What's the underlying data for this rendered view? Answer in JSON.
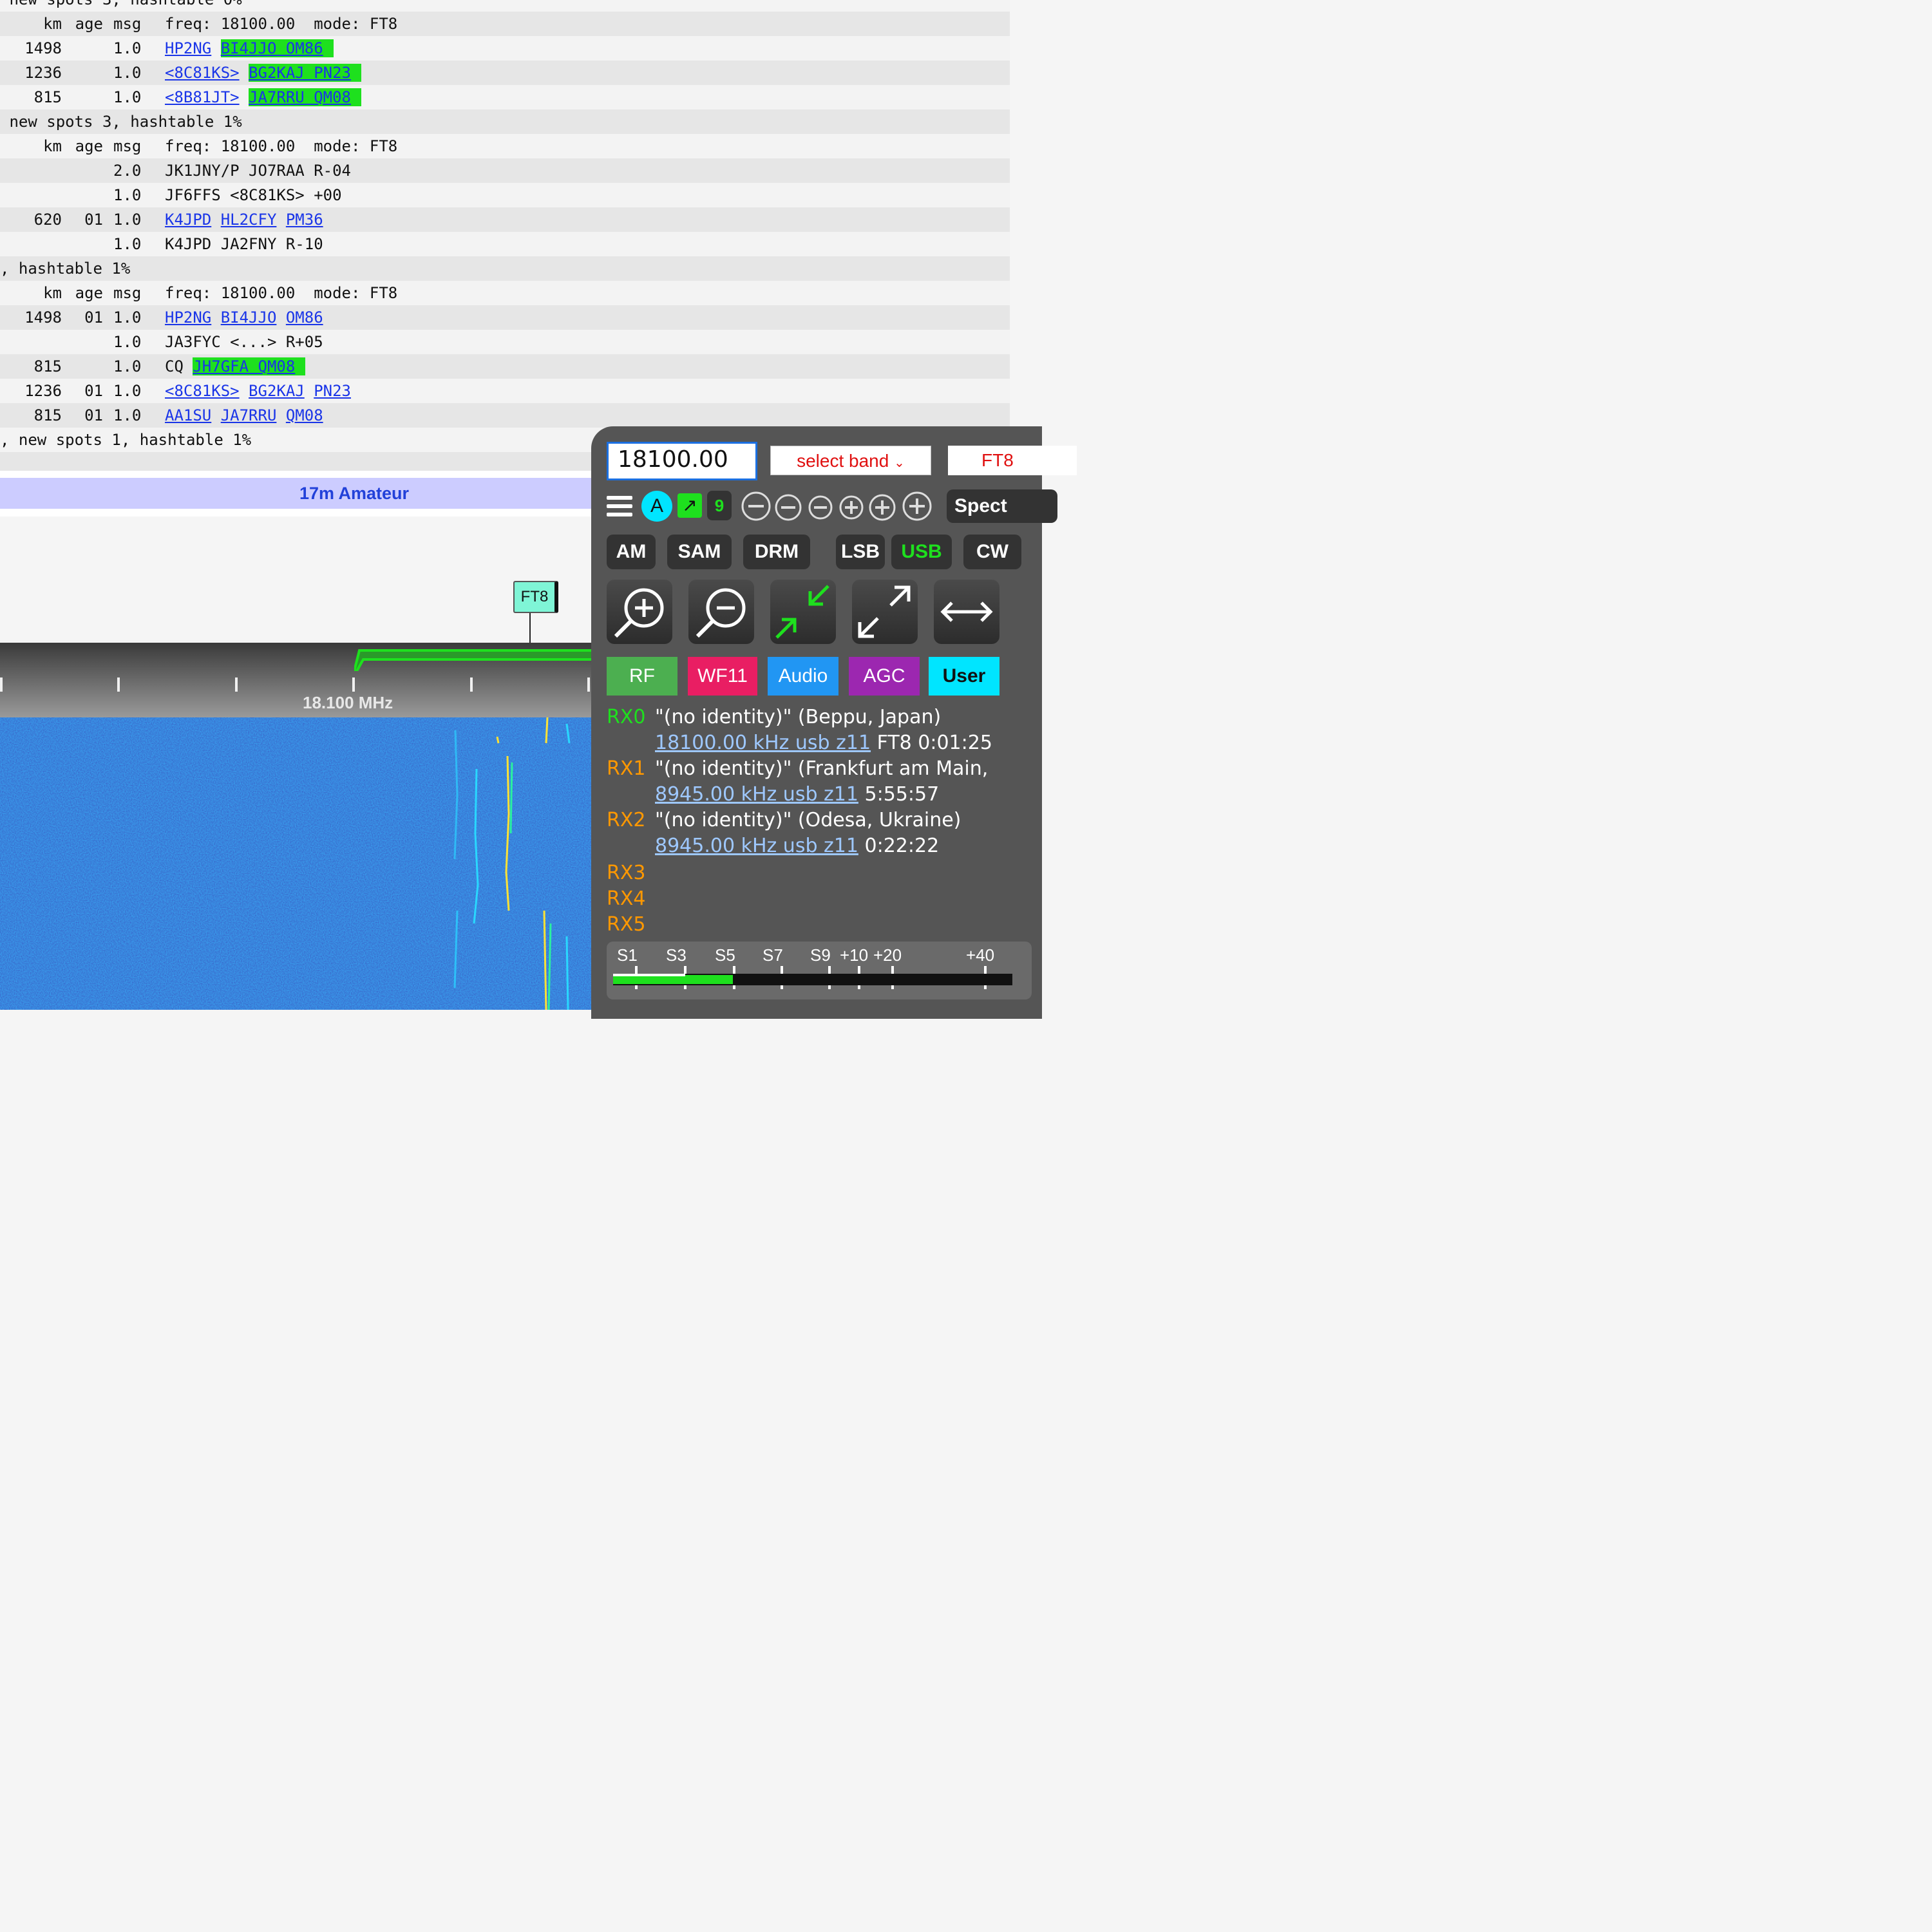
{
  "log": {
    "rows": [
      {
        "type": "status",
        "text": " new spots 3, hashtable 0%"
      },
      {
        "type": "header",
        "km": "km",
        "age": "age",
        "msg": "msg",
        "text": "freq: 18100.00  mode: FT8"
      },
      {
        "type": "spot",
        "km": "1498",
        "age": "",
        "msg": "1.0",
        "parts": [
          {
            "t": "HP2NG",
            "link": true
          },
          {
            "t": "BI4JJO OM86",
            "link": true,
            "hl": true
          }
        ]
      },
      {
        "type": "spot",
        "km": "1236",
        "age": "",
        "msg": "1.0",
        "parts": [
          {
            "t": "<8C81KS>",
            "link": true
          },
          {
            "t": "BG2KAJ PN23",
            "link": true,
            "hl": true
          }
        ]
      },
      {
        "type": "spot",
        "km": "815",
        "age": "",
        "msg": "1.0",
        "parts": [
          {
            "t": "<8B81JT>",
            "link": true
          },
          {
            "t": "JA7RRU QM08",
            "link": true,
            "hl": true
          }
        ]
      },
      {
        "type": "status",
        "text": " new spots 3, hashtable 1%"
      },
      {
        "type": "header",
        "km": "km",
        "age": "age",
        "msg": "msg",
        "text": "freq: 18100.00  mode: FT8"
      },
      {
        "type": "spot",
        "km": "",
        "age": "",
        "msg": "2.0",
        "parts": [
          {
            "t": "JK1JNY/P JO7RAA R-04"
          }
        ]
      },
      {
        "type": "spot",
        "km": "",
        "age": "",
        "msg": "1.0",
        "parts": [
          {
            "t": "JF6FFS <8C81KS> +00"
          }
        ]
      },
      {
        "type": "spot",
        "km": "620",
        "age": "01",
        "msg": "1.0",
        "parts": [
          {
            "t": "K4JPD",
            "link": true
          },
          {
            "t": "HL2CFY",
            "link": true
          },
          {
            "t": "PM36",
            "link": true
          }
        ]
      },
      {
        "type": "spot",
        "km": "",
        "age": "",
        "msg": "1.0",
        "parts": [
          {
            "t": "K4JPD JA2FNY R-10"
          }
        ]
      },
      {
        "type": "status",
        "text": ", hashtable 1%"
      },
      {
        "type": "header",
        "km": "km",
        "age": "age",
        "msg": "msg",
        "text": "freq: 18100.00  mode: FT8"
      },
      {
        "type": "spot",
        "km": "1498",
        "age": "01",
        "msg": "1.0",
        "parts": [
          {
            "t": "HP2NG",
            "link": true
          },
          {
            "t": "BI4JJO",
            "link": true
          },
          {
            "t": "OM86",
            "link": true
          }
        ]
      },
      {
        "type": "spot",
        "km": "",
        "age": "",
        "msg": "1.0",
        "parts": [
          {
            "t": "JA3FYC <...> R+05"
          }
        ]
      },
      {
        "type": "spot",
        "km": "815",
        "age": "",
        "msg": "1.0",
        "parts": [
          {
            "t": "CQ"
          },
          {
            "t": "JH7GFA QM08",
            "link": true,
            "hl": true
          }
        ]
      },
      {
        "type": "spot",
        "km": "1236",
        "age": "01",
        "msg": "1.0",
        "parts": [
          {
            "t": "<8C81KS>",
            "link": true
          },
          {
            "t": "BG2KAJ",
            "link": true
          },
          {
            "t": "PN23",
            "link": true
          }
        ]
      },
      {
        "type": "spot",
        "km": "815",
        "age": "01",
        "msg": "1.0",
        "parts": [
          {
            "t": "AA1SU",
            "link": true
          },
          {
            "t": "JA7RRU",
            "link": true
          },
          {
            "t": "QM08",
            "link": true
          }
        ]
      },
      {
        "type": "status",
        "text": ", new spots 1, hashtable 1%"
      },
      {
        "type": "status",
        "text": ""
      }
    ]
  },
  "band_bar": {
    "label": "17m Amateur"
  },
  "marker": {
    "label": "FT8"
  },
  "scale": {
    "label": "18.100 MHz"
  },
  "controls": {
    "freq_value": "18100.00",
    "band_select": "select band",
    "mode_select": "FT8",
    "agc_letter": "A",
    "nine_badge": "9",
    "spectrum_label": "Spect",
    "modes": [
      {
        "label": "AM",
        "active": false
      },
      {
        "label": "SAM",
        "active": false
      },
      {
        "label": "DRM",
        "active": false
      },
      {
        "label": "LSB",
        "active": false
      },
      {
        "label": "USB",
        "active": true
      },
      {
        "label": "CW",
        "active": false
      }
    ],
    "tabs": [
      {
        "label": "RF",
        "color": "#4caf50",
        "text": "#ffffff"
      },
      {
        "label": "WF11",
        "color": "#e91e63",
        "text": "#ffffff"
      },
      {
        "label": "Audio",
        "color": "#2196f3",
        "text": "#ffffff"
      },
      {
        "label": "AGC",
        "color": "#9c27b0",
        "text": "#ffffff"
      },
      {
        "label": "User",
        "color": "#00e5ff",
        "text": "#111111"
      }
    ]
  },
  "receivers": [
    {
      "id": "RX0",
      "color": "#1ee01e",
      "ident": "\"(no identity)\" (Beppu, Japan)",
      "link": "18100.00 kHz usb z11",
      "extra": "FT8 0:01:25"
    },
    {
      "id": "RX1",
      "color": "#ff9800",
      "ident": "\"(no identity)\" (Frankfurt am Main,",
      "link": "8945.00 kHz usb z11",
      "extra": "5:55:57"
    },
    {
      "id": "RX2",
      "color": "#ff9800",
      "ident": "\"(no identity)\" (Odesa, Ukraine)",
      "link": "8945.00 kHz usb z11",
      "extra": "0:22:22"
    },
    {
      "id": "RX3",
      "color": "#ff9800"
    },
    {
      "id": "RX4",
      "color": "#ff9800"
    },
    {
      "id": "RX5",
      "color": "#ff9800"
    }
  ],
  "smeter": {
    "labels": [
      "S1",
      "S3",
      "S5",
      "S7",
      "S9",
      "+10",
      "+20",
      "+40"
    ],
    "level_fraction": 0.3
  }
}
